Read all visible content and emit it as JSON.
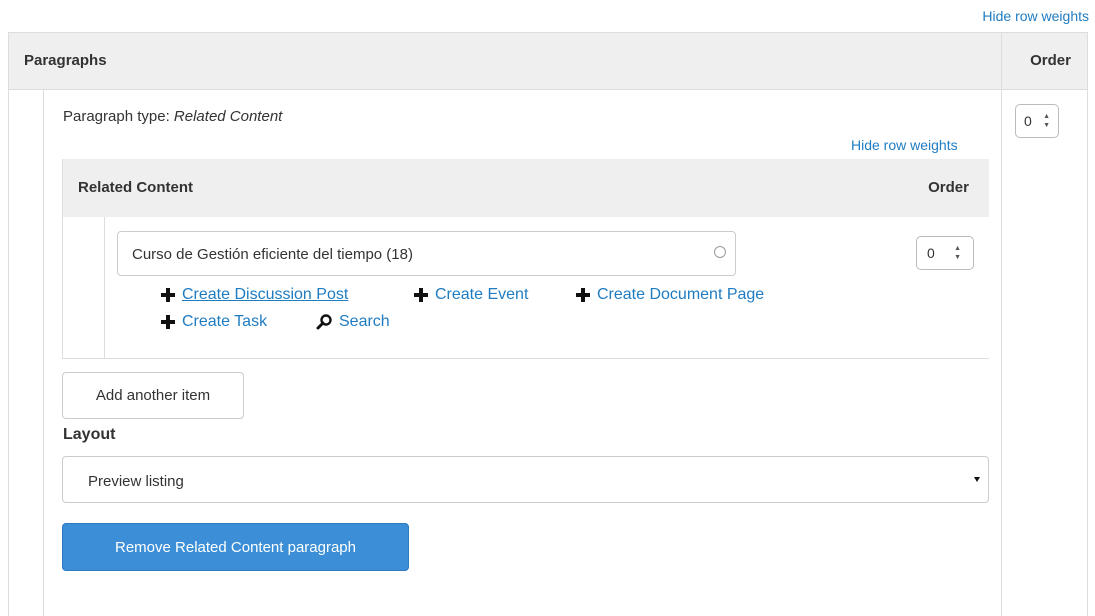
{
  "top_link": "Hide row weights",
  "outer_table": {
    "header_paragraphs": "Paragraphs",
    "header_order": "Order",
    "order_value": "0"
  },
  "paragraph": {
    "type_label": "Paragraph type:",
    "type_value": "Related Content",
    "hide_weights_link": "Hide row weights",
    "inner_table": {
      "header_title": "Related Content",
      "header_order": "Order",
      "field_value": "Curso de Gestión eficiente del tiempo (18)",
      "order_value": "0",
      "actions_row1": [
        "Create Discussion Post",
        "Create Event",
        "Create Document Page"
      ],
      "actions_row2": [
        "Create Task",
        "Search"
      ]
    },
    "add_item_button": "Add another item",
    "layout_label": "Layout",
    "layout_value": "Preview listing",
    "remove_button": "Remove Related Content paragraph"
  },
  "colors": {
    "link": "#1f7cc1",
    "primary_button": "#3c8fd6",
    "header_bg": "#efefef"
  }
}
